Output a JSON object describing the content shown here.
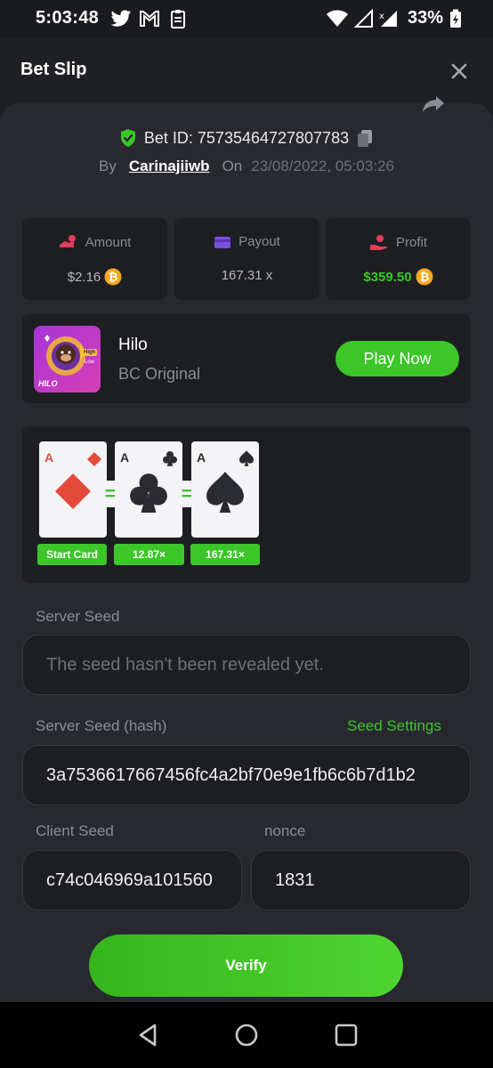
{
  "status_bar": {
    "time": "5:03:48",
    "battery": "33%",
    "icons": [
      "twitter-icon",
      "gmail-icon",
      "clipboard-icon",
      "wifi-icon",
      "signal-icon",
      "signal-x-icon",
      "battery-charging-icon"
    ]
  },
  "header": {
    "title": "Bet Slip",
    "close_icon": "close-icon"
  },
  "bet": {
    "id_label": "Bet ID: 75735464727807783",
    "by_label": "By",
    "user": "Carinajiiwb",
    "on_label": "On",
    "date": "23/08/2022, 05:03:26"
  },
  "stats": [
    {
      "label": "Amount",
      "value": "$2.16",
      "icon": "amount-icon",
      "coin": true
    },
    {
      "label": "Payout",
      "value": "167.31 x",
      "icon": "wallet-icon",
      "coin": false
    },
    {
      "label": "Profit",
      "value": "$359.50",
      "icon": "profit-hand-icon",
      "coin": true
    }
  ],
  "game": {
    "name": "Hilo",
    "provider": "BC Original",
    "play_label": "Play Now",
    "thumb_text": "HILO",
    "thumb_high": "High",
    "thumb_low": "Low"
  },
  "hand": {
    "cards": [
      {
        "rank": "A",
        "suit": "diamond"
      },
      {
        "rank": "A",
        "suit": "club"
      },
      {
        "rank": "A",
        "suit": "spade"
      }
    ],
    "tags": [
      "Start Card",
      "12.87×",
      "167.31×"
    ],
    "equals": "="
  },
  "fields": {
    "server_seed_label": "Server Seed",
    "server_seed_placeholder": "The seed hasn't been revealed yet.",
    "server_hash_label": "Server Seed (hash)",
    "seed_settings": "Seed Settings",
    "server_hash_value": "3a7536617667456fc4a2bf70e9e1fb6c6b7d1b2",
    "client_seed_label": "Client Seed",
    "client_seed_value": "c74c046969a101560",
    "nonce_label": "nonce",
    "nonce_value": "1831"
  },
  "verify_label": "Verify",
  "colors": {
    "accent_green": "#3cc629",
    "background": "#1d1e21",
    "panel": "#27292e",
    "card": "#1d1e22"
  }
}
